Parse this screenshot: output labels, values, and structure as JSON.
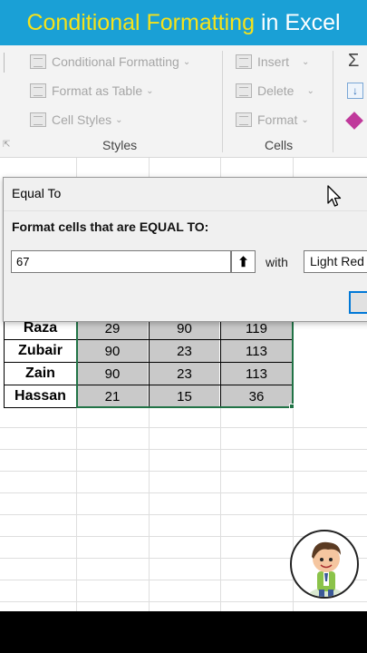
{
  "banner": {
    "title_part1": "Conditional Formatting",
    "title_part2": "in Excel",
    "colors": {
      "background": "#1aa0d6",
      "highlight": "#f6e21a",
      "text": "#ffffff"
    }
  },
  "ribbon": {
    "styles_group": {
      "conditional_formatting": "Conditional Formatting",
      "format_as_table": "Format as Table",
      "cell_styles": "Cell Styles",
      "label": "Styles"
    },
    "cells_group": {
      "insert": "Insert",
      "delete": "Delete",
      "format": "Format",
      "label": "Cells"
    },
    "editing_icons": [
      "sum-icon",
      "fill-down-icon",
      "clear-eraser-icon"
    ]
  },
  "dialog": {
    "title": "Equal To",
    "prompt": "Format cells that are EQUAL TO:",
    "value": "67",
    "with_label": "with",
    "format_option": "Light Red Fill with Dark Red Text"
  },
  "table": {
    "rows": [
      {
        "name": "Raza",
        "a": "29",
        "b": "90",
        "total": "119"
      },
      {
        "name": "Zubair",
        "a": "90",
        "b": "23",
        "total": "113"
      },
      {
        "name": "Zain",
        "a": "90",
        "b": "23",
        "total": "113"
      },
      {
        "name": "Hassan",
        "a": "21",
        "b": "15",
        "total": "36"
      }
    ]
  },
  "colors": {
    "selection": "#217346",
    "cell_fill": "#c9c9c9",
    "dialog_bg": "#f0f0f0"
  }
}
